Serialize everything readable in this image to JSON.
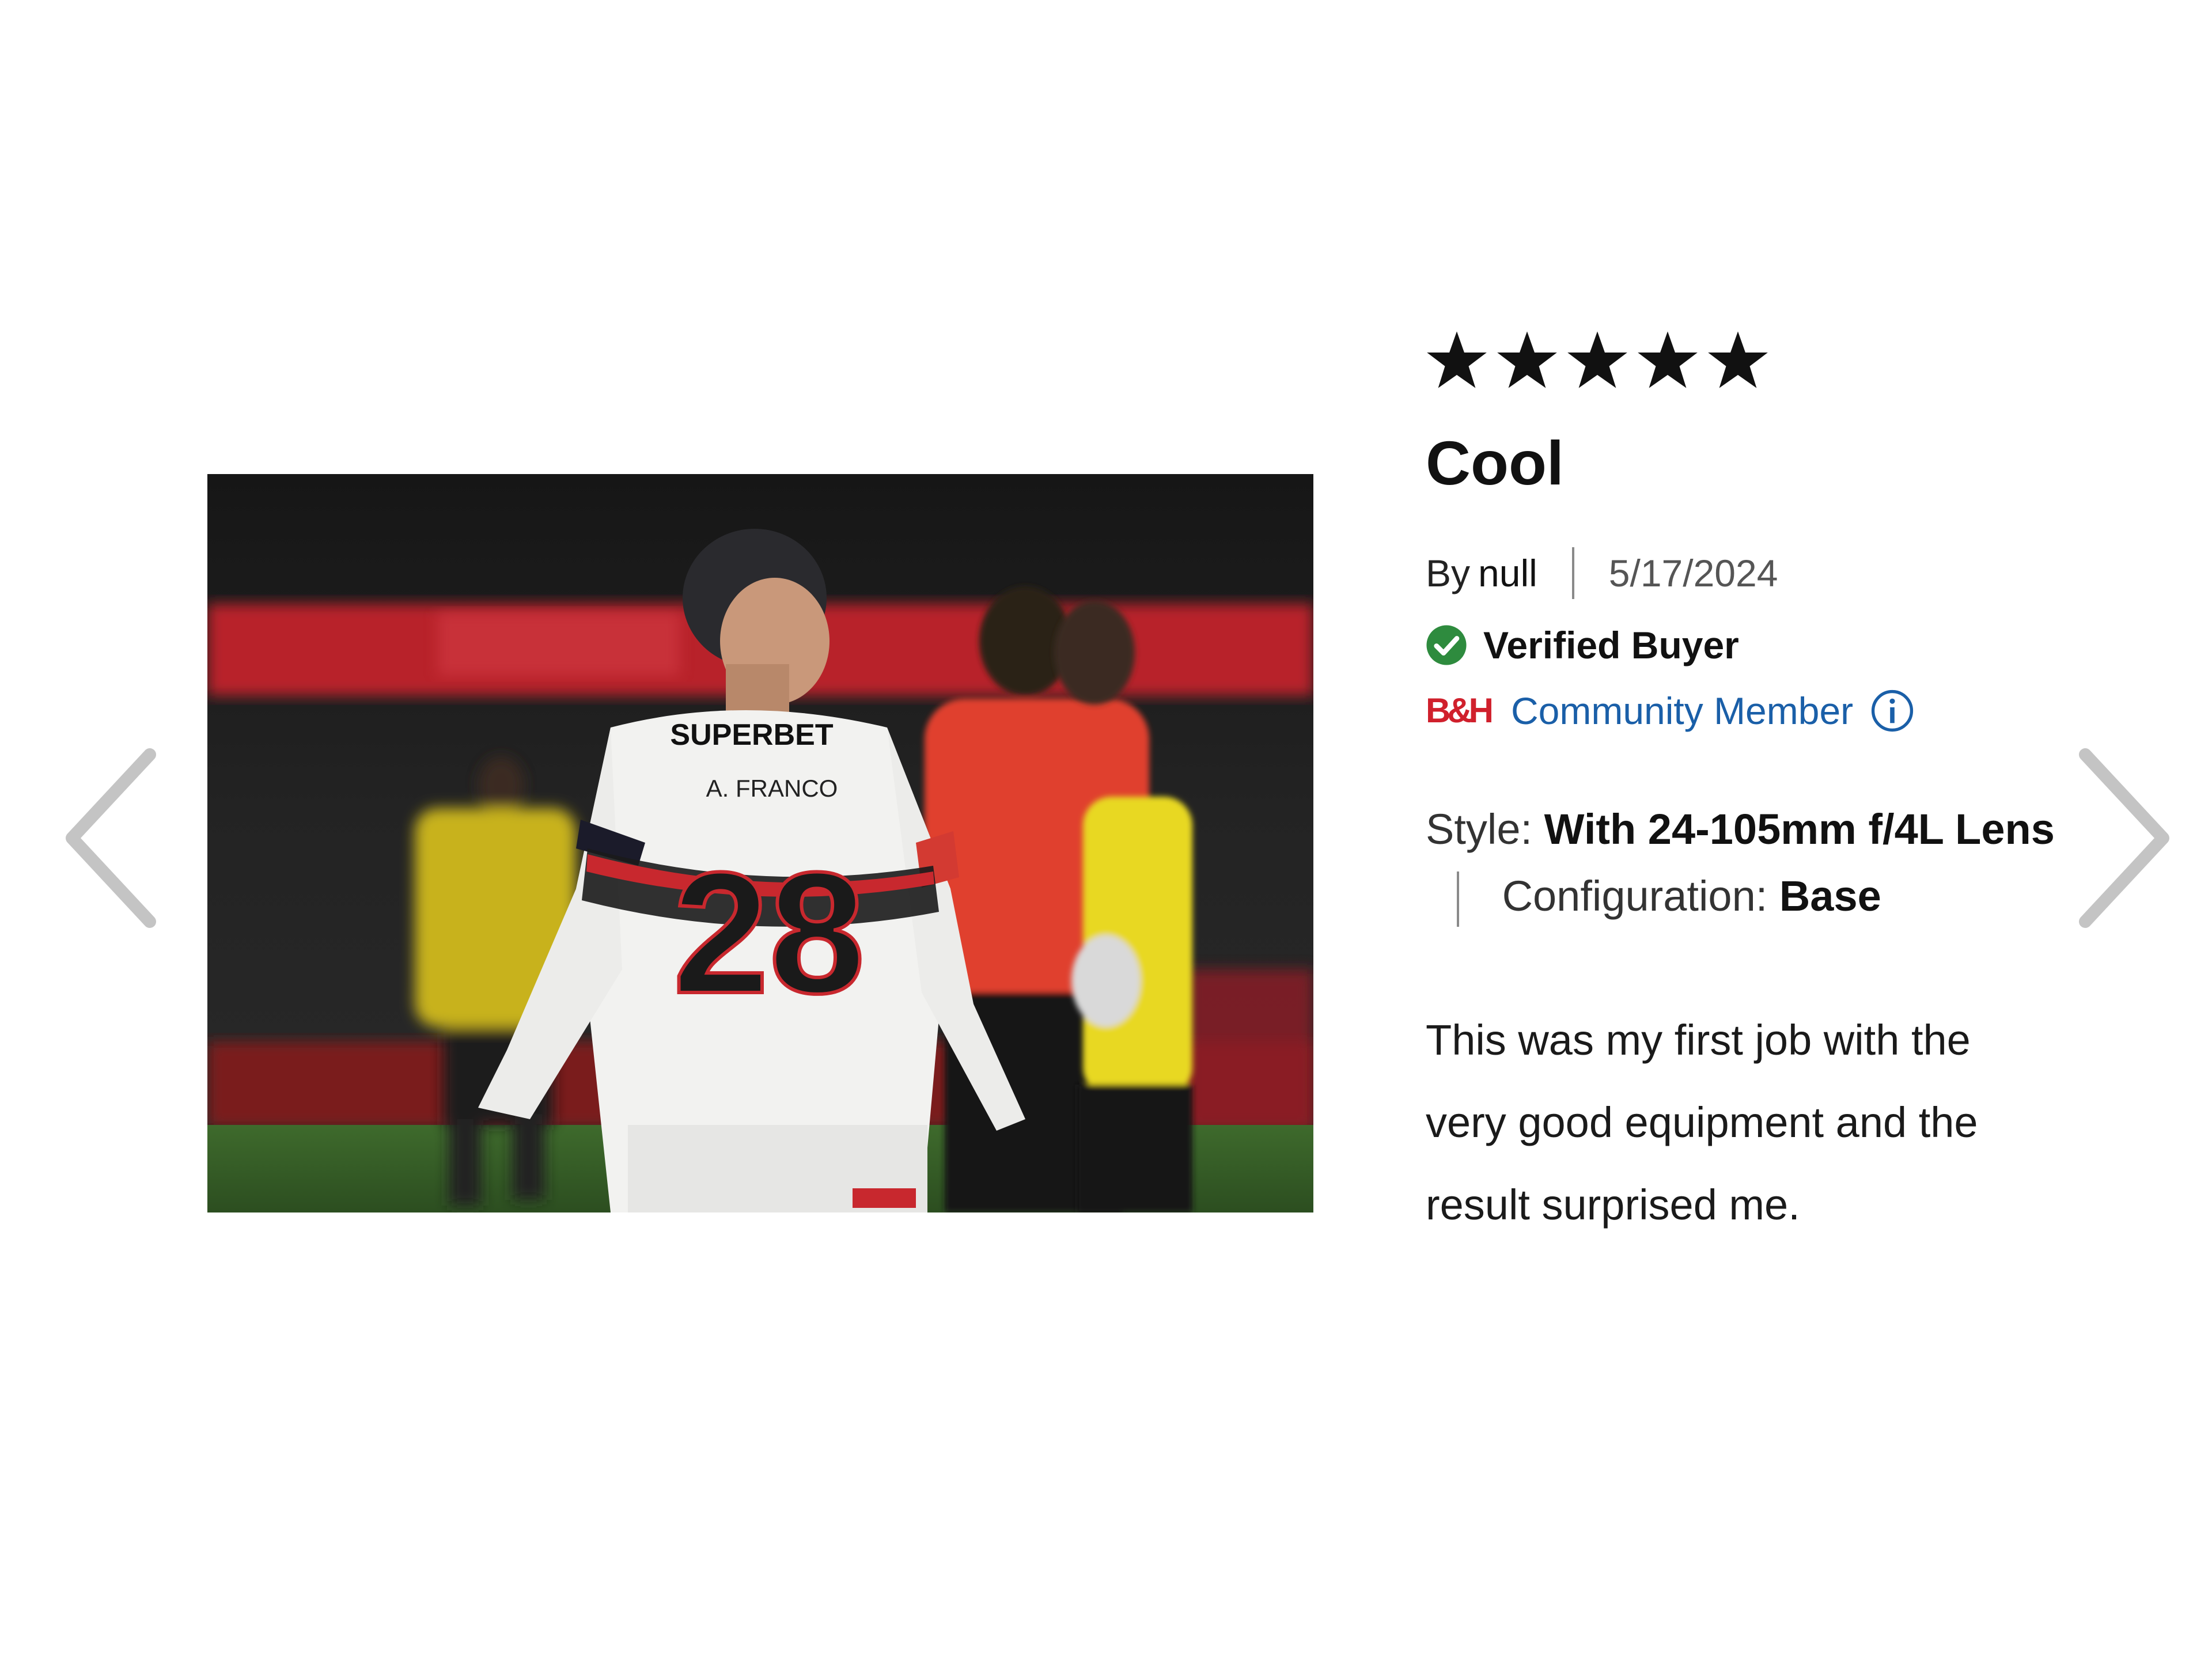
{
  "review": {
    "rating": 5,
    "max_rating": 5,
    "title": "Cool",
    "author_prefix": "By",
    "author": "null",
    "date": "5/17/2024",
    "verified_label": "Verified Buyer",
    "community_brand": "B&H",
    "community_label": "Community Member",
    "specs": {
      "style_label": "Style:",
      "style_value": "With 24-105mm f/4L Lens",
      "config_label": "Configuration:",
      "config_value": "Base"
    },
    "body": "This was my first job with the very good equipment and the result surprised me."
  },
  "photo": {
    "jersey_sponsor": "SUPERBET",
    "jersey_name": "A. FRANCO",
    "jersey_number": "28"
  },
  "icons": {
    "prev": "chevron-left-icon",
    "next": "chevron-right-icon",
    "star": "star-icon",
    "verified": "check-circle-icon",
    "info": "info-icon"
  },
  "colors": {
    "verified_green": "#2e8b3e",
    "community_blue": "#1a5fa8",
    "brand_red": "#d0202c",
    "arrow_gray": "#c4c4c4"
  }
}
